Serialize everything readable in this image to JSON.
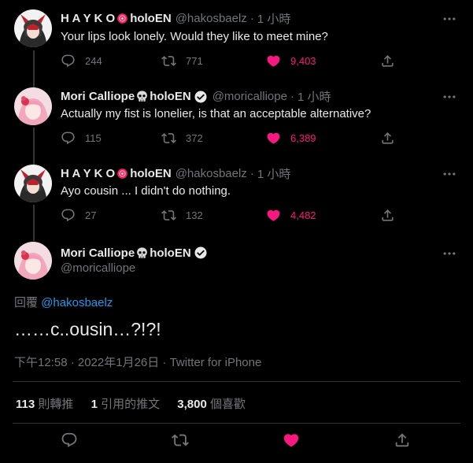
{
  "tweets": [
    {
      "name": "H A Y K O",
      "name_suffix": "holoEN",
      "handle": "@hakosbaelz",
      "time": "1 小時",
      "text": "Your lips look lonely. Would they like to meet mine?",
      "replies": "244",
      "retweets": "771",
      "likes": "9,403"
    },
    {
      "name": "Mori Calliope",
      "name_suffix": "holoEN",
      "handle": "@moricalliope",
      "time": "1 小時",
      "text": "Actually my fist is lonelier, is that an acceptable alternative?",
      "replies": "115",
      "retweets": "372",
      "likes": "6,389"
    },
    {
      "name": "H A Y K O",
      "name_suffix": "holoEN",
      "handle": "@hakosbaelz",
      "time": "1 小時",
      "text": "Ayo cousin ... I didn't do nothing.",
      "replies": "27",
      "retweets": "132",
      "likes": "4,482"
    }
  ],
  "main": {
    "name": "Mori Calliope",
    "name_suffix": "holoEN",
    "handle": "@moricalliope",
    "reply_prefix": "回覆",
    "reply_to": "@hakosbaelz",
    "text": "……c..ousin…?!?!",
    "timestamp": "下午12:58 · 2022年1月26日 · Twitter for iPhone",
    "stats": {
      "retweets_count": "113",
      "retweets_label": "則轉推",
      "quotes_count": "1",
      "quotes_label": "引用的推文",
      "likes_count": "3,800",
      "likes_label": "個喜歡"
    }
  },
  "colors": {
    "background": "#000000",
    "text": "#e7e9ea",
    "muted": "#71767b",
    "link": "#1d9bf0",
    "like": "#f91880",
    "divider": "#2f3336"
  },
  "icons": {
    "reply": "reply-icon",
    "retweet": "retweet-icon",
    "like": "heart-icon",
    "share": "share-icon",
    "more": "more-icon",
    "verified": "verified-icon",
    "skull": "skull-emoji-icon",
    "gem": "red-gem-emoji-icon"
  }
}
